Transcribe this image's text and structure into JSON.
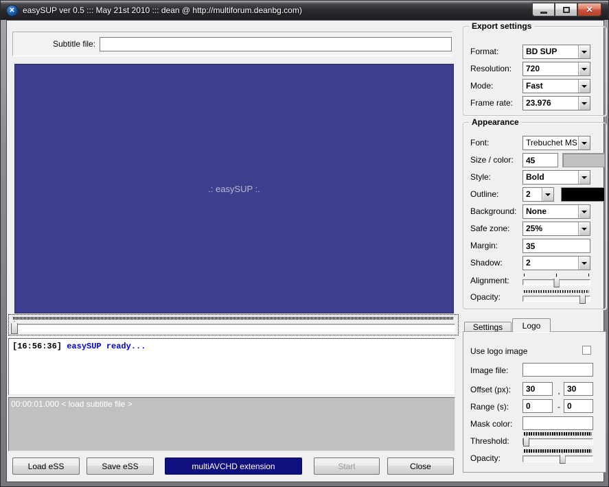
{
  "titlebar": {
    "title": "easySUP ver 0.5 ::: May 21st 2010 ::: dean @ http://multiforum.deanbg.com)",
    "app_icon_glyph": "✕",
    "close_glyph": "✕"
  },
  "subtitle": {
    "label": "Subtitle file:",
    "value": "",
    "placeholder": ""
  },
  "preview": {
    "watermark": ".: easySUP :."
  },
  "log": {
    "time": "[16:56:36]",
    "message": "easySUP ready..."
  },
  "timeline": {
    "item": "00:00:01.000 < load subtitle file >"
  },
  "actions": {
    "load": "Load eSS",
    "save": "Save eSS",
    "multiavchd": "multiAVCHD extension",
    "start": "Start",
    "close": "Close"
  },
  "export_settings": {
    "title": "Export settings",
    "rows": [
      {
        "label": "Format:",
        "value": "BD SUP"
      },
      {
        "label": "Resolution:",
        "value": "720"
      },
      {
        "label": "Mode:",
        "value": "Fast"
      },
      {
        "label": "Frame rate:",
        "value": "23.976"
      }
    ]
  },
  "appearance": {
    "title": "Appearance",
    "font_label": "Font:",
    "font_value": "Trebuchet MS",
    "size_color_label": "Size / color:",
    "size_value": "45",
    "style_label": "Style:",
    "style_value": "Bold",
    "outline_label": "Outline:",
    "outline_value": "2",
    "background_label": "Background:",
    "background_value": "None",
    "safe_zone_label": "Safe zone:",
    "safe_zone_value": "25%",
    "margin_label": "Margin:",
    "margin_value": "35",
    "shadow_label": "Shadow:",
    "shadow_value": "2",
    "alignment_label": "Alignment:",
    "opacity_label": "Opacity:"
  },
  "tabs": {
    "settings": "Settings",
    "logo": "Logo",
    "active": "Logo"
  },
  "logo_tab": {
    "use_logo_label": "Use logo image",
    "use_logo_checked": false,
    "image_file_label": "Image file:",
    "image_file_value": "",
    "offset_label": "Offset (px):",
    "offset_x": "30",
    "offset_separator": ",",
    "offset_y": "30",
    "range_label": "Range (s):",
    "range_from": "0",
    "range_separator": "-",
    "range_to": "0",
    "mask_color_label": "Mask color:",
    "mask_color_value": "",
    "threshold_label": "Threshold:",
    "opacity_label": "Opacity:"
  },
  "colors": {
    "preview_background": "#3e3e8e",
    "accent_button_background": "#10107e",
    "log_message_text": "#0000dd",
    "timeline_background": "#c0c0c0",
    "text_color_swatch": "#c0c0c0",
    "outline_color_swatch": "#000000",
    "titlebar_background": "#2e2e32"
  }
}
